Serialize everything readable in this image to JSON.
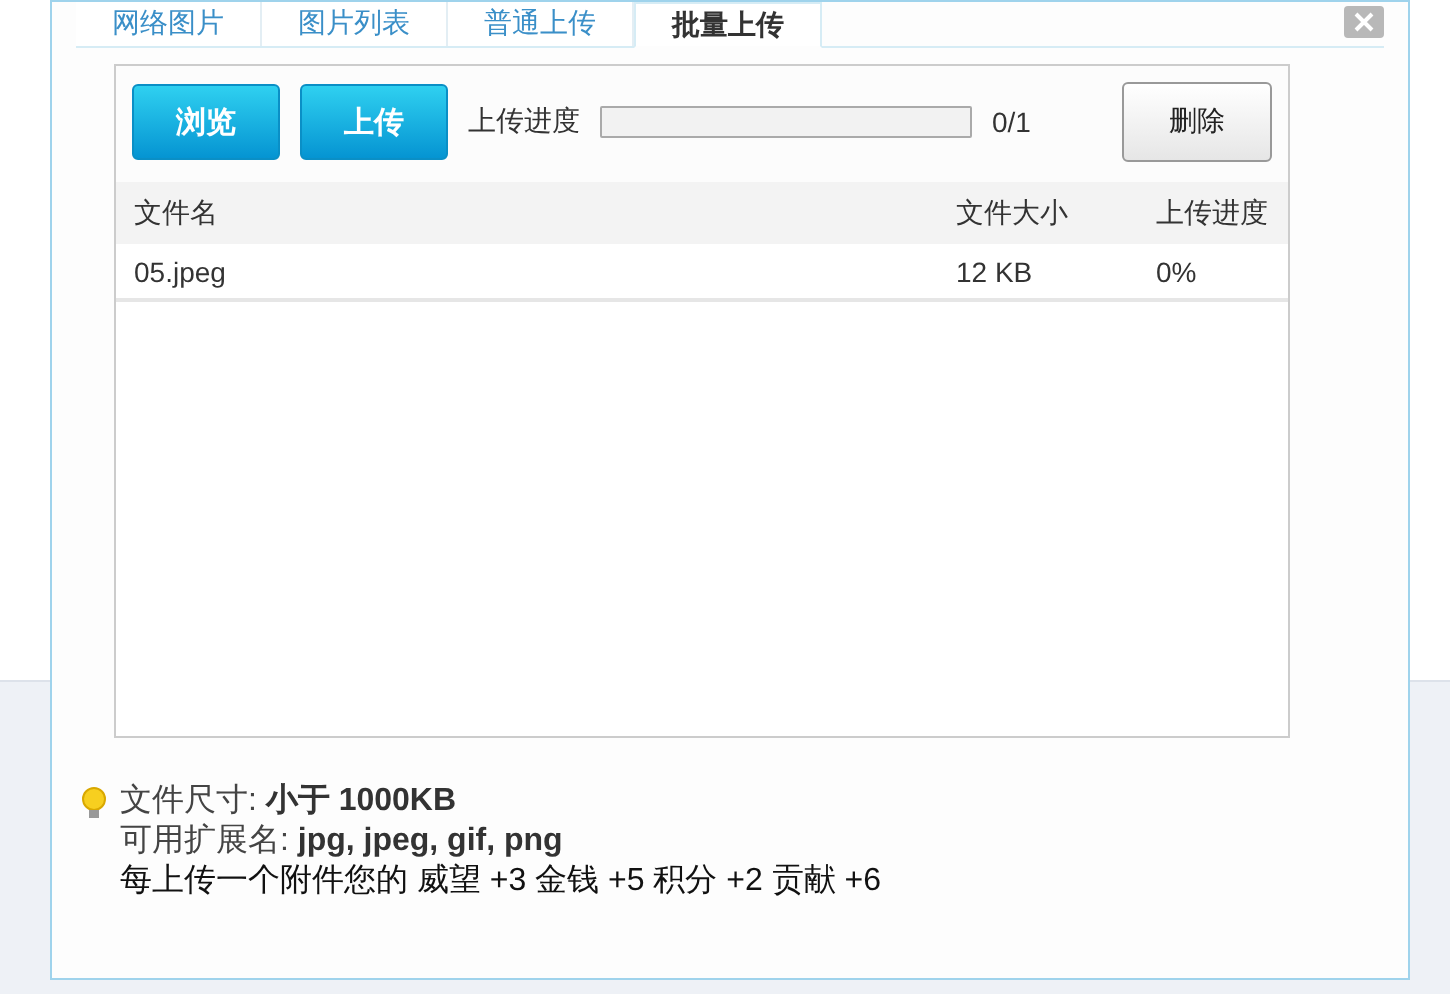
{
  "tabs": [
    {
      "label": "网络图片",
      "selected": false
    },
    {
      "label": "图片列表",
      "selected": false
    },
    {
      "label": "普通上传",
      "selected": false
    },
    {
      "label": "批量上传",
      "selected": true
    }
  ],
  "toolbar": {
    "browse_button": "浏览",
    "upload_button": "上传",
    "progress_label": "上传进度",
    "progress": {
      "level": 0
    },
    "progress_text": "0/1",
    "delete_button": "删除"
  },
  "table": {
    "columns": [
      "文件名",
      "文件大小",
      "上传进度"
    ],
    "rows": [
      {
        "cells": [
          "05.jpeg",
          "12 KB",
          "0%"
        ]
      }
    ]
  },
  "tips": [
    "文件尺寸: **小于 1000KB**",
    "可用扩展名: **jpg, jpeg, gif, png**",
    "每上传一个附件您的 威望 +3  金钱 +5  积分 +2  贡献 +6"
  ]
}
